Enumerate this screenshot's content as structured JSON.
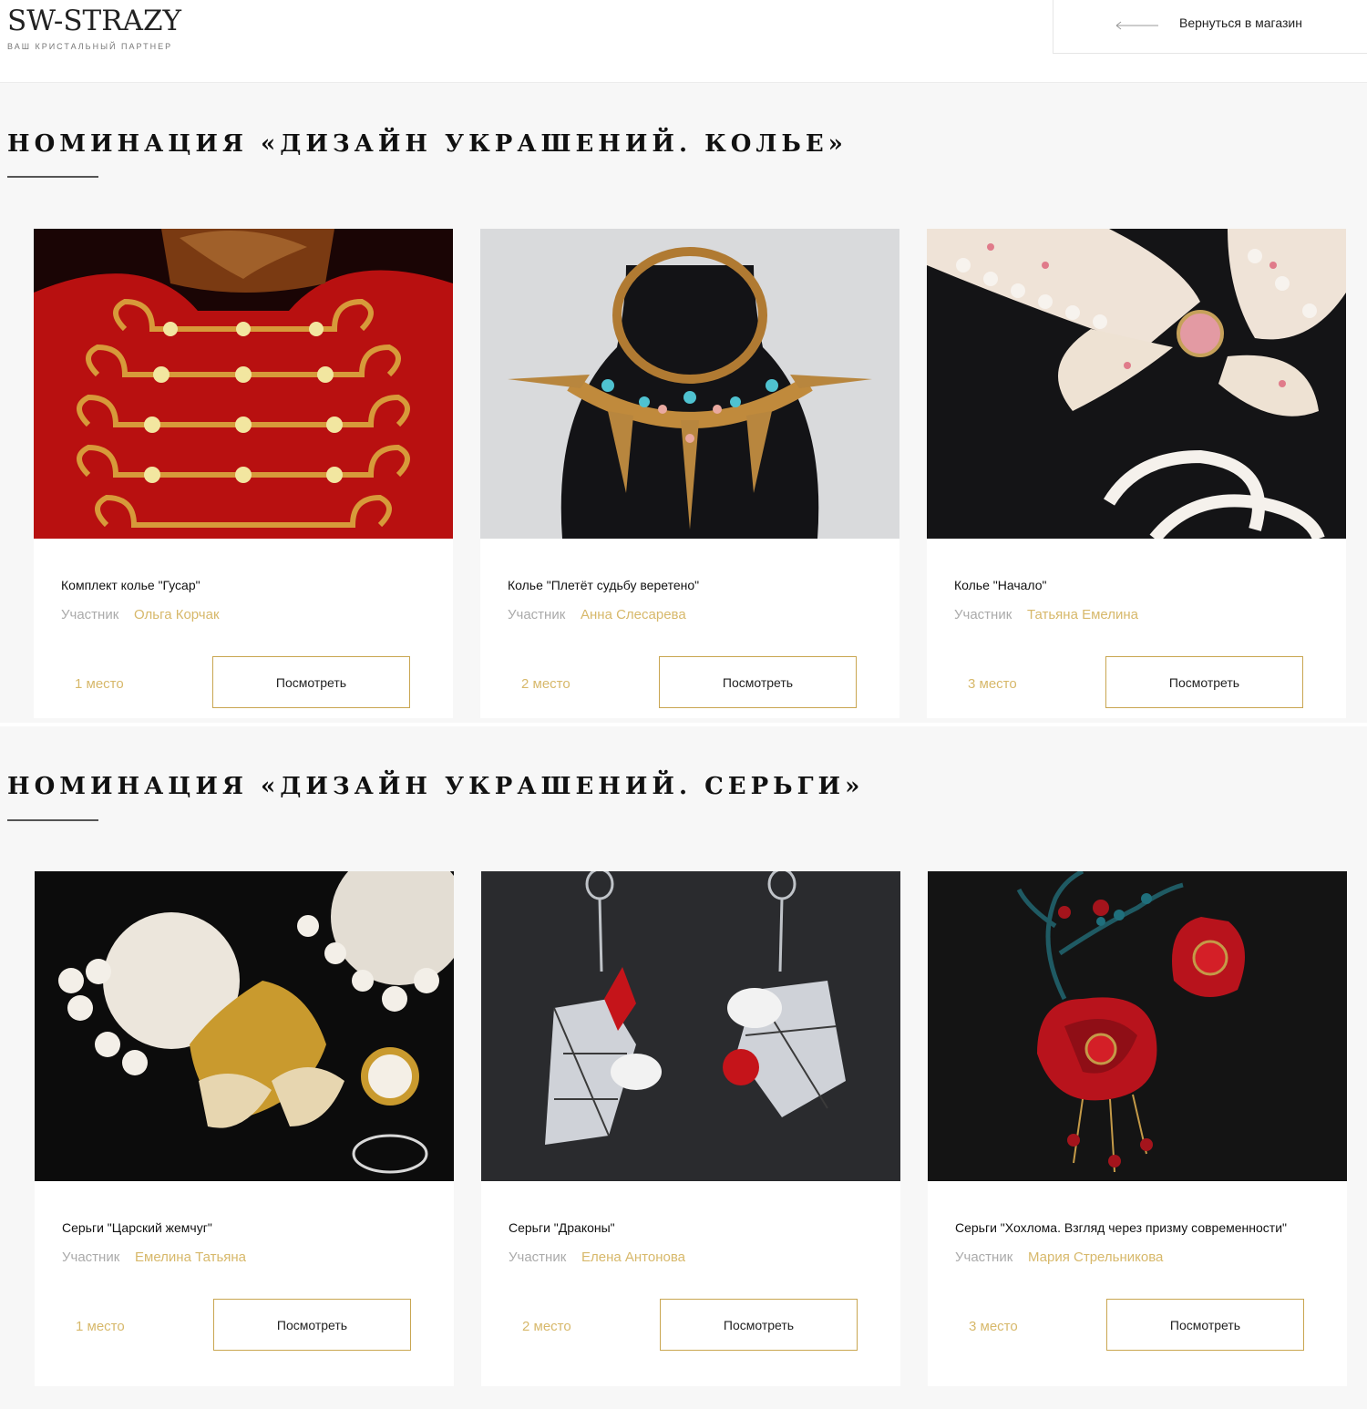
{
  "header": {
    "logo_title": "SW-STRAZY",
    "logo_subtitle": "ВАШ КРИСТАЛЬНЫЙ ПАРТНЕР",
    "back_label": "Вернуться в магазин"
  },
  "sections": [
    {
      "title": "НОМИНАЦИЯ «ДИЗАЙН УКРАШЕНИЙ. КОЛЬЕ»",
      "cards": [
        {
          "name": "Комплект колье \"Гусар\"",
          "participant_label": "Участник",
          "participant": "Ольга Корчак",
          "place": "1 место",
          "button": "Посмотреть"
        },
        {
          "name": "Колье \"Плетёт судьбу веретено\"",
          "participant_label": "Участник",
          "participant": "Анна Слесарева",
          "place": "2 место",
          "button": "Посмотреть"
        },
        {
          "name": "Колье \"Начало\"",
          "participant_label": "Участник",
          "participant": "Татьяна Емелина",
          "place": "3 место",
          "button": "Посмотреть"
        }
      ]
    },
    {
      "title": "НОМИНАЦИЯ «ДИЗАЙН УКРАШЕНИЙ. СЕРЬГИ»",
      "cards": [
        {
          "name": "Серьги \"Царский жемчуг\"",
          "participant_label": "Участник",
          "participant": "Емелина Татьяна",
          "place": "1 место",
          "button": "Посмотреть"
        },
        {
          "name": "Серьги \"Драконы\"",
          "participant_label": "Участник",
          "participant": "Елена Антонова",
          "place": "2 место",
          "button": "Посмотреть"
        },
        {
          "name": "Серьги \"Хохлома. Взгляд через призму современности\"",
          "participant_label": "Участник",
          "participant": "Мария Стрельникова",
          "place": "3 место",
          "button": "Посмотреть"
        }
      ]
    }
  ],
  "colors": {
    "accent_gold": "#d7b86a",
    "button_border": "#c9a651",
    "section_bg": "#f7f7f7"
  }
}
